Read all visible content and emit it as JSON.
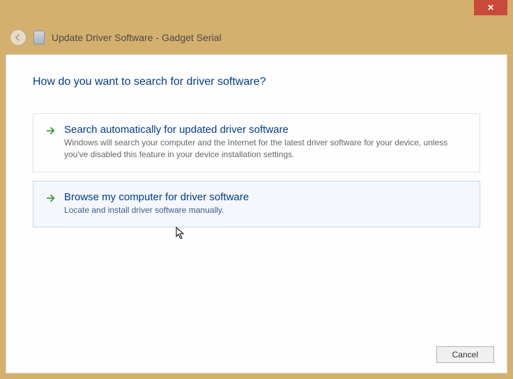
{
  "titlebar": {
    "close_symbol": "✕"
  },
  "header": {
    "title": "Update Driver Software - Gadget Serial"
  },
  "main": {
    "heading": "How do you want to search for driver software?",
    "options": [
      {
        "title": "Search automatically for updated driver software",
        "description": "Windows will search your computer and the Internet for the latest driver software for your device, unless you've disabled this feature in your device installation settings."
      },
      {
        "title": "Browse my computer for driver software",
        "description": "Locate and install driver software manually."
      }
    ]
  },
  "buttons": {
    "cancel": "Cancel"
  }
}
